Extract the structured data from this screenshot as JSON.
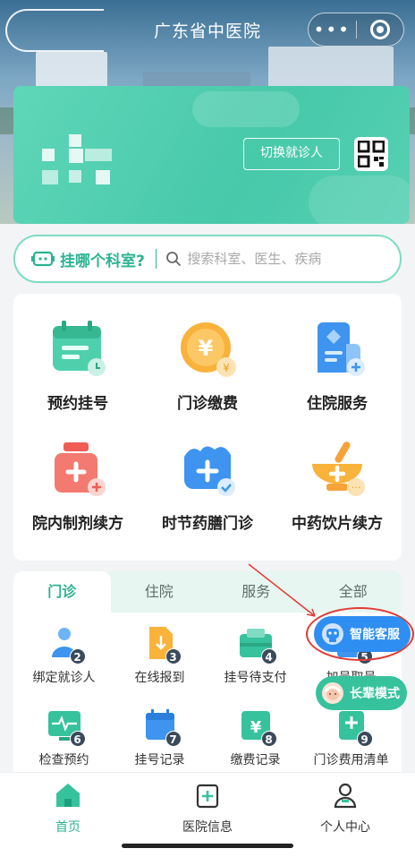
{
  "header": {
    "title": "广东省中医院",
    "capsule_more": "•••"
  },
  "patient_card": {
    "switch_label": "切换就诊人"
  },
  "dept_search": {
    "label": "挂哪个科室?",
    "placeholder": "搜索科室、医生、疾病"
  },
  "services": [
    {
      "label": "预约挂号",
      "icon": "calendar-icon"
    },
    {
      "label": "门诊缴费",
      "icon": "yuan-coin-icon"
    },
    {
      "label": "住院服务",
      "icon": "hospital-building-icon"
    },
    {
      "label": "院内制剂续方",
      "icon": "medicine-bottle-icon"
    },
    {
      "label": "时节药膳门诊",
      "icon": "herbal-diet-icon"
    },
    {
      "label": "中药饮片续方",
      "icon": "mortar-pestle-icon"
    }
  ],
  "tabs": [
    {
      "label": "门诊",
      "active": true
    },
    {
      "label": "住院",
      "active": false
    },
    {
      "label": "服务",
      "active": false
    },
    {
      "label": "全部",
      "active": false
    }
  ],
  "grid": [
    {
      "label": "绑定就诊人",
      "badge": "2",
      "icon": "user-bind-icon"
    },
    {
      "label": "在线报到",
      "badge": "3",
      "icon": "checkin-doc-icon"
    },
    {
      "label": "挂号待支付",
      "badge": "4",
      "icon": "pending-payment-icon"
    },
    {
      "label": "加号取号",
      "badge": "5",
      "icon": "add-number-icon"
    },
    {
      "label": "检查预约",
      "badge": "6",
      "icon": "exam-monitor-icon"
    },
    {
      "label": "挂号记录",
      "badge": "7",
      "icon": "calendar-record-icon"
    },
    {
      "label": "缴费记录",
      "badge": "8",
      "icon": "payment-record-icon"
    },
    {
      "label": "门诊费用清单",
      "badge": "9",
      "icon": "fee-list-icon"
    }
  ],
  "floating": {
    "ai_service": "智能客服",
    "elder_mode": "长辈模式"
  },
  "bottom_nav": [
    {
      "label": "首页",
      "active": true
    },
    {
      "label": "医院信息",
      "active": false
    },
    {
      "label": "个人中心",
      "active": false
    }
  ],
  "colors": {
    "accent": "#2db391",
    "card_green": "#4fcdae",
    "ai_blue": "#2f8ef2",
    "annotation_red": "#e23b35"
  }
}
